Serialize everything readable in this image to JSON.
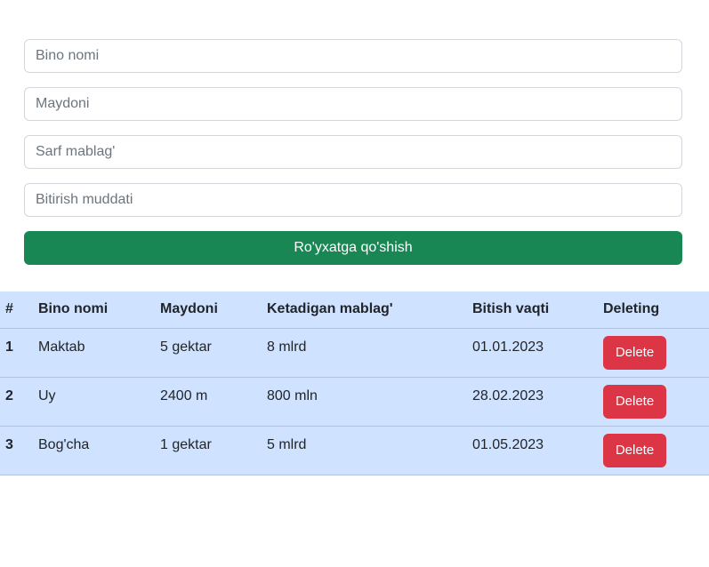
{
  "form": {
    "name_placeholder": "Bino nomi",
    "area_placeholder": "Maydoni",
    "cost_placeholder": "Sarf mablag'",
    "deadline_placeholder": "Bitirish muddati",
    "submit_label": "Ro'yxatga qo'shish"
  },
  "table": {
    "headers": [
      "#",
      "Bino nomi",
      "Maydoni",
      "Ketadigan mablag'",
      "Bitish vaqti",
      "Deleting"
    ],
    "rows": [
      {
        "num": "1",
        "name": "Maktab",
        "area": "5 gektar",
        "cost": "8 mlrd",
        "date": "01.01.2023",
        "action": "Delete"
      },
      {
        "num": "2",
        "name": "Uy",
        "area": "2400 m",
        "cost": "800 mln",
        "date": "28.02.2023",
        "action": "Delete"
      },
      {
        "num": "3",
        "name": "Bog'cha",
        "area": "1 gektar",
        "cost": "5 mlrd",
        "date": "01.05.2023",
        "action": "Delete"
      }
    ]
  },
  "colors": {
    "submit_bg": "#198754",
    "delete_bg": "#dc3545",
    "table_bg": "#cfe2ff"
  }
}
